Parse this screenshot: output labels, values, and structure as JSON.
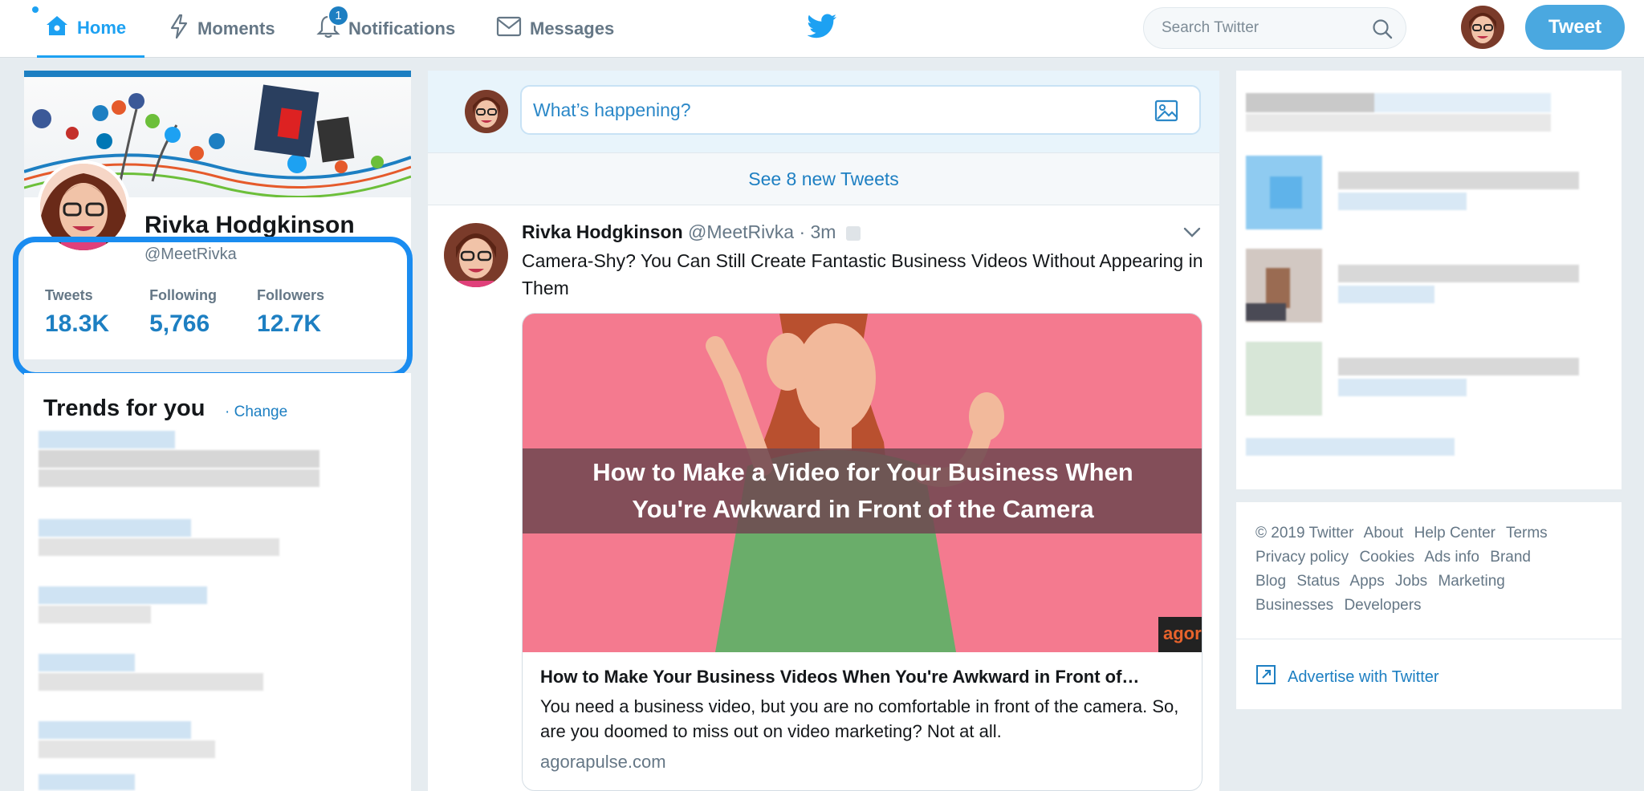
{
  "nav": {
    "home": "Home",
    "moments": "Moments",
    "notifications": "Notifications",
    "notifications_badge": "1",
    "messages": "Messages",
    "search_placeholder": "Search Twitter",
    "tweet_button": "Tweet"
  },
  "profile": {
    "name": "Rivka Hodgkinson",
    "handle": "@MeetRivka",
    "stats": [
      {
        "label": "Tweets",
        "value": "18.3K"
      },
      {
        "label": "Following",
        "value": "5,766"
      },
      {
        "label": "Followers",
        "value": "12.7K"
      }
    ]
  },
  "trends": {
    "title": "Trends for you",
    "change": "· Change"
  },
  "compose": {
    "placeholder": "What’s happening?"
  },
  "timeline": {
    "new_tweets": "See 8 new Tweets"
  },
  "tweet": {
    "name": "Rivka Hodgkinson",
    "handle": "@MeetRivka",
    "time": "· 3m",
    "text": "Camera-Shy? You Can Still Create Fantastic Business Videos Without Appearing in Them",
    "card": {
      "image_line1": "How to Make a Video for Your Business When",
      "image_line2": "You're Awkward in Front of the Camera",
      "image_brand": "agora",
      "title": "How to Make Your Business Videos When You're Awkward in Front of…",
      "description": "You need a business video, but you are no comfortable in front of the camera. So, are you doomed to miss out on video marketing? Not at all.",
      "domain": "agorapulse.com"
    }
  },
  "footer": {
    "links": [
      "© 2019 Twitter",
      "About",
      "Help Center",
      "Terms",
      "Privacy policy",
      "Cookies",
      "Ads info",
      "Brand",
      "Blog",
      "Status",
      "Apps",
      "Jobs",
      "Marketing",
      "Businesses",
      "Developers"
    ],
    "advertise": "Advertise with Twitter"
  },
  "colors": {
    "accent": "#1da1f2",
    "link": "#1d7fc2",
    "highlight_ring": "#1a8cf0",
    "card_image_bg": "#f47a8f"
  }
}
